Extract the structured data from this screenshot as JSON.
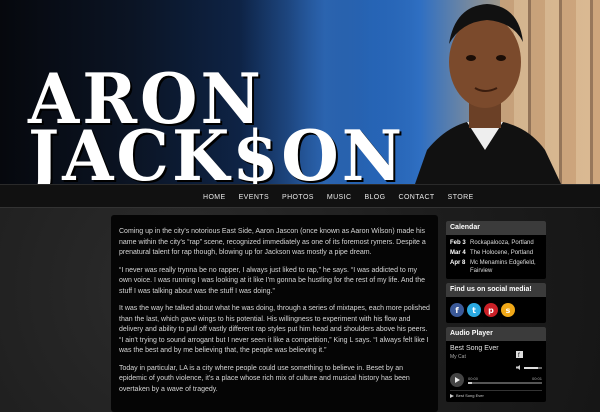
{
  "header": {
    "name_line1": "ARON",
    "name_line2": "JACK$ON"
  },
  "nav": {
    "items": [
      "HOME",
      "EVENTS",
      "PHOTOS",
      "MUSIC",
      "BLOG",
      "CONTACT",
      "STORE"
    ]
  },
  "content": {
    "paragraphs": [
      "Coming up in the city's notorious East Side, Aaron Jascon (once known as Aaron Wilson) made his name within the city's “rap” scene, recognized immediately as one of its foremost rymers. Despite a prenatural talent for rap though, blowing up for Jackson was mostly a pipe dream.",
      "“I never was really trynna be no rapper, I always just liked to rap,” he says. “I was addicted to my own voice. I was running I was looking at it like I'm gonna be hustling for the rest of my life. And the stuff I was talking about was the stuff I was doing.”",
      "It was the way he talked about what he was doing, through a series of mixtapes, each more polished than the last, which gave wings to his potential. His willingness to experiment with his flow and delivery and ability to pull off vastly different rap styles put him head and shoulders above his peers. “I ain't trying to sound arrogant but I never seen it like a competition,” King L says. “I always felt like I was the best and by me believing that, the people was believing it.”",
      "Today in particular, LA is a city where people could use something to believe in. Beset by an epidemic of youth violence, it's a place whose rich mix of culture and musical history has been overtaken by a wave of tragedy."
    ]
  },
  "calendar": {
    "title": "Calendar",
    "events": [
      {
        "date": "Feb 3",
        "text": "Rockapalooza,  Portland"
      },
      {
        "date": "Mar 4",
        "text": "The Holocene,  Portland"
      },
      {
        "date": "Apr 8",
        "text": "Mc Menamins Edgefield, Fairview"
      }
    ]
  },
  "social": {
    "title": "Find us on social media!",
    "icons": [
      {
        "name": "facebook-icon",
        "glyph": "f",
        "color": "#3b5998"
      },
      {
        "name": "twitter-icon",
        "glyph": "t",
        "color": "#2aa9e0"
      },
      {
        "name": "pinterest-icon",
        "glyph": "p",
        "color": "#cb2027"
      },
      {
        "name": "soundcloud-icon",
        "glyph": "s",
        "color": "#f0a818"
      }
    ]
  },
  "audio": {
    "title": "Audio Player",
    "track_title": "Best Song Ever",
    "artist": "My Cat",
    "time_current": "00:00",
    "time_total": "00:01",
    "volume_fraction": 0.8,
    "progress_fraction": 0.05,
    "playlist_item": "Best Song Ever"
  }
}
